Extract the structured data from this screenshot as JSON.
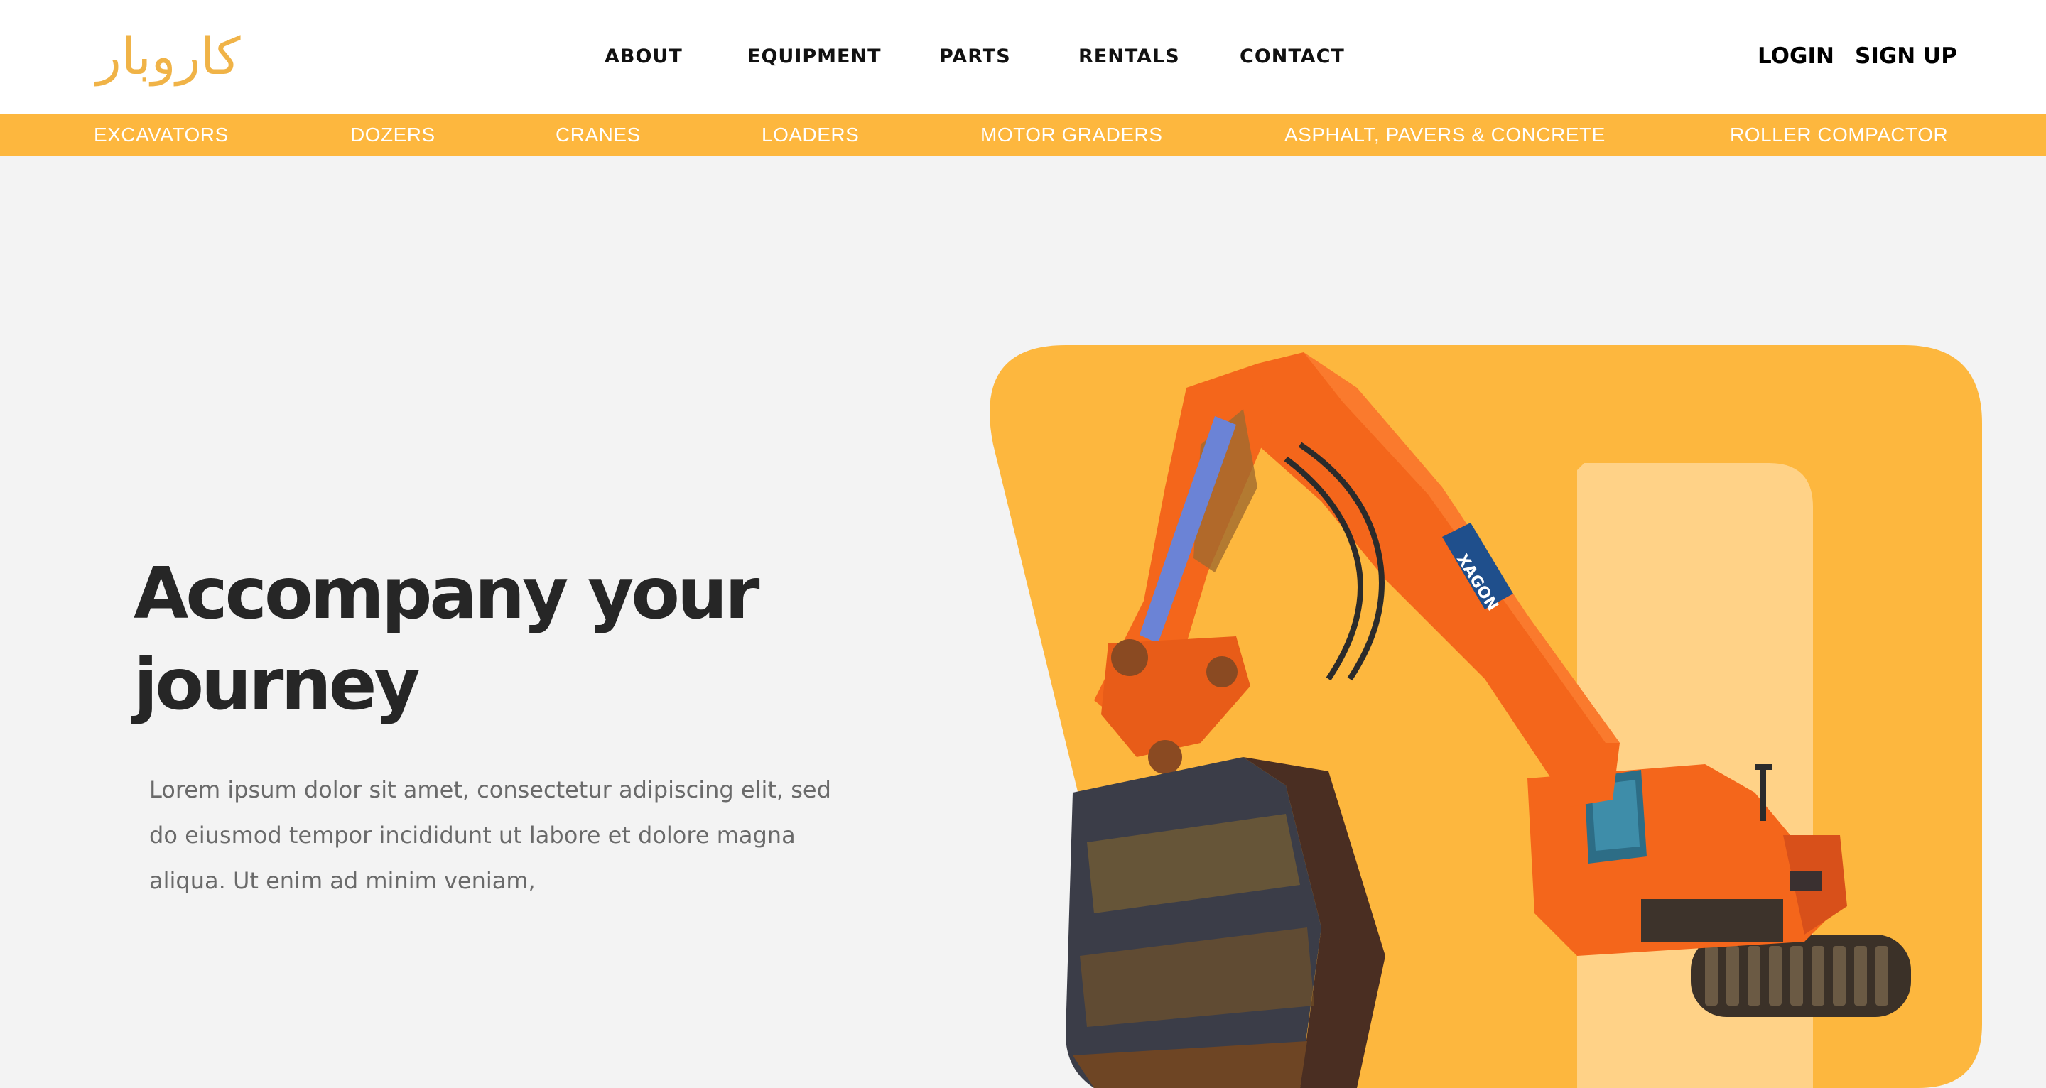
{
  "brand": {
    "logo_text": "کاروبار",
    "accent_color": "#fdb73e"
  },
  "nav": {
    "items": [
      {
        "label": "ABOUT"
      },
      {
        "label": "EQUIPMENT"
      },
      {
        "label": "PARTS"
      },
      {
        "label": "RENTALS"
      },
      {
        "label": "CONTACT"
      }
    ]
  },
  "auth": {
    "login": "LOGIN",
    "signup": "SIGN UP"
  },
  "categories": [
    {
      "label": "EXCAVATORS"
    },
    {
      "label": "DOZERS"
    },
    {
      "label": "CRANES"
    },
    {
      "label": "LOADERS"
    },
    {
      "label": "MOTOR GRADERS"
    },
    {
      "label": "ASPHALT, PAVERS & CONCRETE"
    },
    {
      "label": "ROLLER COMPACTOR"
    }
  ],
  "hero": {
    "title": "Accompany your journey",
    "description": "Lorem ipsum dolor sit amet, consectetur adipiscing elit, sed do eiusmod tempor incididunt ut labore et dolore magna aliqua. Ut enim ad minim veniam,",
    "image_subject": "excavator-illustration",
    "excavator_brand_text": "XAGON"
  },
  "colors": {
    "card_bg": "#fdb73e",
    "card_inner": "#ffd287",
    "machine_orange": "#f4661b",
    "page_bg": "#f3f3f3"
  }
}
